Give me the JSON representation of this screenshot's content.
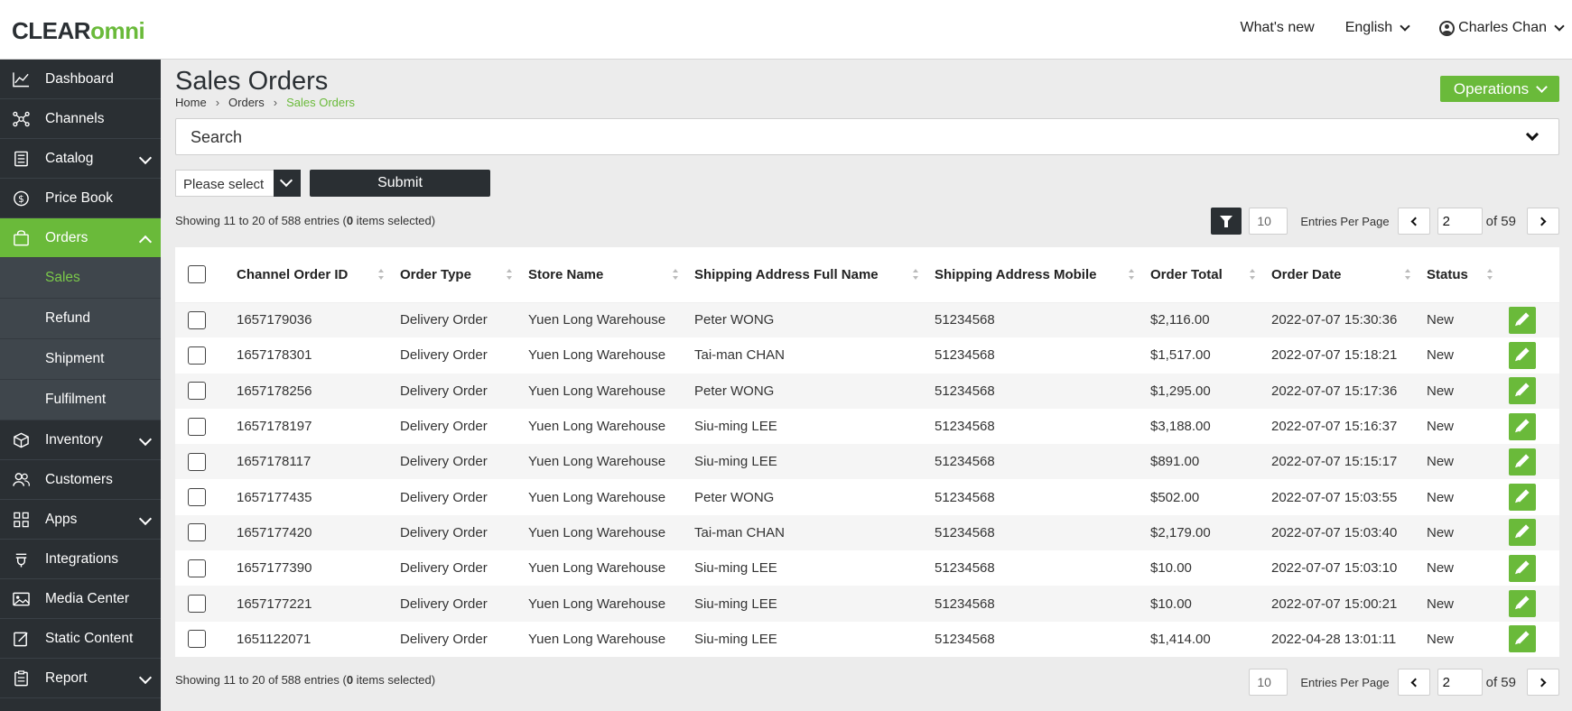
{
  "brand": {
    "logo_main": "CLEAR",
    "logo_accent": "omni",
    "accent_color": "#6aba3a",
    "dark_color": "#2a2f33"
  },
  "topnav": {
    "whats_new": "What's new",
    "language": "English",
    "user": "Charles Chan"
  },
  "sidebar": {
    "items": [
      {
        "label": "Dashboard",
        "icon": "chart-line-icon"
      },
      {
        "label": "Channels",
        "icon": "network-icon"
      },
      {
        "label": "Catalog",
        "icon": "book-icon"
      },
      {
        "label": "Price Book",
        "icon": "dollar-circle-icon"
      },
      {
        "label": "Orders",
        "icon": "shopping-bag-icon"
      },
      {
        "label": "Inventory",
        "icon": "box-icon"
      },
      {
        "label": "Customers",
        "icon": "users-icon"
      },
      {
        "label": "Apps",
        "icon": "grid-icon"
      },
      {
        "label": "Integrations",
        "icon": "plug-icon"
      },
      {
        "label": "Media Center",
        "icon": "image-icon"
      },
      {
        "label": "Static Content",
        "icon": "edit-doc-icon"
      },
      {
        "label": "Report",
        "icon": "clipboard-icon"
      }
    ],
    "orders_sub": [
      "Sales",
      "Refund",
      "Shipment",
      "Fulfilment"
    ]
  },
  "page": {
    "title": "Sales Orders",
    "breadcrumb": [
      "Home",
      "Orders",
      "Sales Orders"
    ],
    "operations_label": "Operations",
    "search_label": "Search",
    "select_value": "Please select",
    "submit_label": "Submit"
  },
  "pagination": {
    "showing_prefix": "Showing 11 to 20 of 588 entries (",
    "selected_count": "0",
    "showing_suffix": " items selected)",
    "per_page": "10",
    "per_page_label": "Entries Per Page",
    "current_page": "2",
    "of_label": "of 59"
  },
  "table": {
    "headers": [
      "Channel Order ID",
      "Order Type",
      "Store Name",
      "Shipping Address Full Name",
      "Shipping Address Mobile",
      "Order Total",
      "Order Date",
      "Status"
    ],
    "rows": [
      [
        "1657179036",
        "Delivery Order",
        "Yuen Long Warehouse",
        "Peter WONG",
        "51234568",
        "$2,116.00",
        "2022-07-07 15:30:36",
        "New"
      ],
      [
        "1657178301",
        "Delivery Order",
        "Yuen Long Warehouse",
        "Tai-man CHAN",
        "51234568",
        "$1,517.00",
        "2022-07-07 15:18:21",
        "New"
      ],
      [
        "1657178256",
        "Delivery Order",
        "Yuen Long Warehouse",
        "Peter WONG",
        "51234568",
        "$1,295.00",
        "2022-07-07 15:17:36",
        "New"
      ],
      [
        "1657178197",
        "Delivery Order",
        "Yuen Long Warehouse",
        "Siu-ming LEE",
        "51234568",
        "$3,188.00",
        "2022-07-07 15:16:37",
        "New"
      ],
      [
        "1657178117",
        "Delivery Order",
        "Yuen Long Warehouse",
        "Siu-ming LEE",
        "51234568",
        "$891.00",
        "2022-07-07 15:15:17",
        "New"
      ],
      [
        "1657177435",
        "Delivery Order",
        "Yuen Long Warehouse",
        "Peter WONG",
        "51234568",
        "$502.00",
        "2022-07-07 15:03:55",
        "New"
      ],
      [
        "1657177420",
        "Delivery Order",
        "Yuen Long Warehouse",
        "Tai-man CHAN",
        "51234568",
        "$2,179.00",
        "2022-07-07 15:03:40",
        "New"
      ],
      [
        "1657177390",
        "Delivery Order",
        "Yuen Long Warehouse",
        "Siu-ming LEE",
        "51234568",
        "$10.00",
        "2022-07-07 15:03:10",
        "New"
      ],
      [
        "1657177221",
        "Delivery Order",
        "Yuen Long Warehouse",
        "Siu-ming LEE",
        "51234568",
        "$10.00",
        "2022-07-07 15:00:21",
        "New"
      ],
      [
        "1651122071",
        "Delivery Order",
        "Yuen Long Warehouse",
        "Siu-ming LEE",
        "51234568",
        "$1,414.00",
        "2022-04-28 13:01:11",
        "New"
      ]
    ]
  }
}
